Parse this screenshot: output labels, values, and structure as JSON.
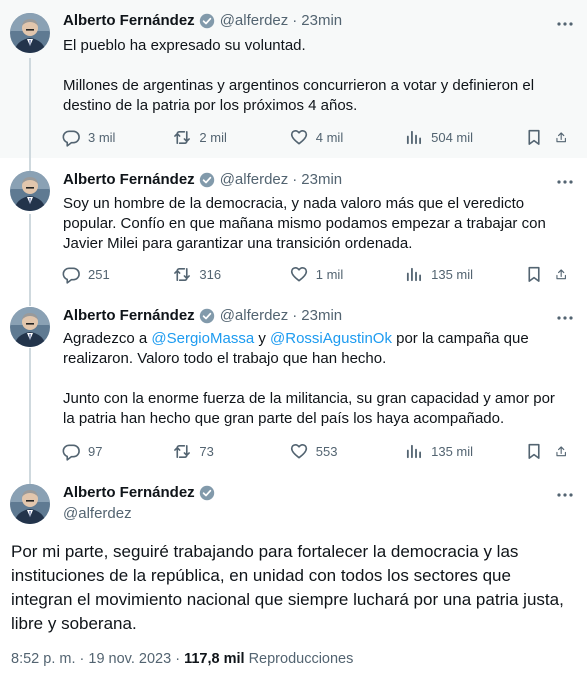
{
  "author": {
    "name": "Alberto Fernández",
    "handle": "@alferdez"
  },
  "tweets": [
    {
      "time": "23min",
      "paragraphs": [
        "El pueblo ha expresado su voluntad.",
        "Millones de argentinas y argentinos concurrieron a votar y definieron el destino de la patria por los próximos 4 años."
      ],
      "replies": "3 mil",
      "reposts": "2 mil",
      "likes": "4 mil",
      "views": "504 mil"
    },
    {
      "time": "23min",
      "paragraphs": [
        "Soy un hombre de la democracia, y nada valoro más que el veredicto popular. Confío en que mañana mismo podamos empezar a trabajar con Javier Milei para garantizar una transición ordenada."
      ],
      "replies": "251",
      "reposts": "316",
      "likes": "1 mil",
      "views": "135 mil"
    },
    {
      "time": "23min",
      "paragraph1": {
        "before": "Agradezco a ",
        "mention1": "@SergioMassa",
        "middle": " y ",
        "mention2": "@RossiAgustinOk",
        "after": " por la campaña que realizaron. Valoro todo el trabajo que han hecho."
      },
      "paragraph2": "Junto con la enorme fuerza de la militancia, su gran capacidad y amor por la patria han hecho que gran parte del país los haya acompañado.",
      "replies": "97",
      "reposts": "73",
      "likes": "553",
      "views": "135 mil"
    }
  ],
  "main_tweet": {
    "text": "Por mi parte, seguiré trabajando para fortalecer la democracia y las instituciones de la república, en unidad con todos los sectores que integran el movimiento nacional que siempre luchará por una patria justa, libre y soberana.",
    "time": "8:52 p. m.",
    "dot": "·",
    "date": "19 nov. 2023",
    "views": "117,8 mil",
    "views_label": "Reproducciones"
  },
  "colors": {
    "accent": "#1d9bf0",
    "text": "#0f1419",
    "muted": "#536471",
    "shaded_bg": "#f7f9f9",
    "thread_line": "#cfd9de"
  },
  "icons": [
    "verified-badge-icon",
    "more-icon",
    "reply-icon",
    "repost-icon",
    "like-icon",
    "views-icon",
    "bookmark-icon",
    "share-icon"
  ]
}
